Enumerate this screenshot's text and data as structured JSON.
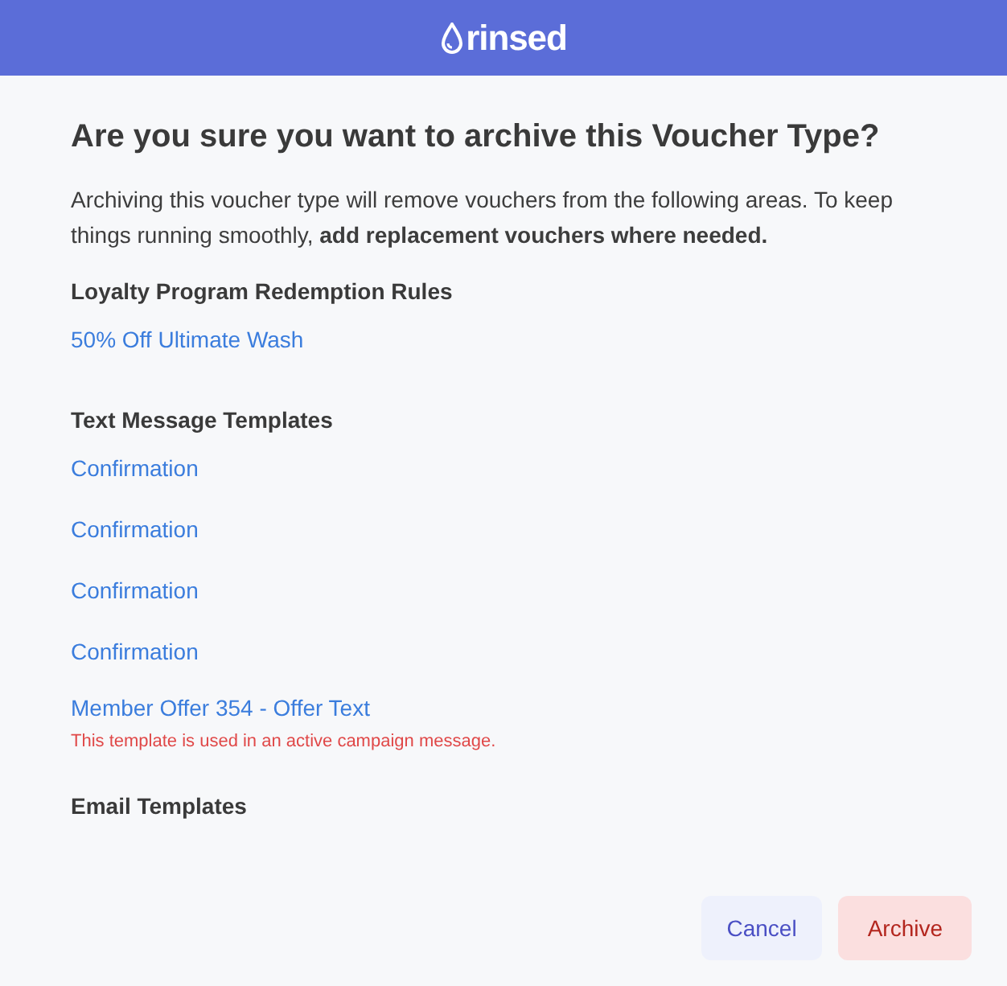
{
  "header": {
    "logo_text": "rinsed"
  },
  "title": "Are you sure you want to archive this Voucher Type?",
  "description": "Archiving this voucher type will remove vouchers from the following areas. To keep things running smoothly, **add replacement vouchers where needed.**",
  "sections": [
    {
      "heading": "Loyalty Program Redemption Rules",
      "items": [
        {
          "label": "50% Off Ultimate Wash"
        }
      ]
    },
    {
      "heading": "Text Message Templates",
      "items": [
        {
          "label": "Confirmation"
        },
        {
          "label": "Confirmation"
        },
        {
          "label": "Confirmation"
        },
        {
          "label": "Confirmation"
        },
        {
          "label": "Member Offer 354 - Offer Text",
          "warning": "This template is used in an active campaign message."
        }
      ]
    },
    {
      "heading": "Email Templates"
    }
  ],
  "buttons": [
    {
      "label": "Cancel",
      "kind": "secondary"
    },
    {
      "label": "Archive",
      "kind": "danger"
    }
  ]
}
